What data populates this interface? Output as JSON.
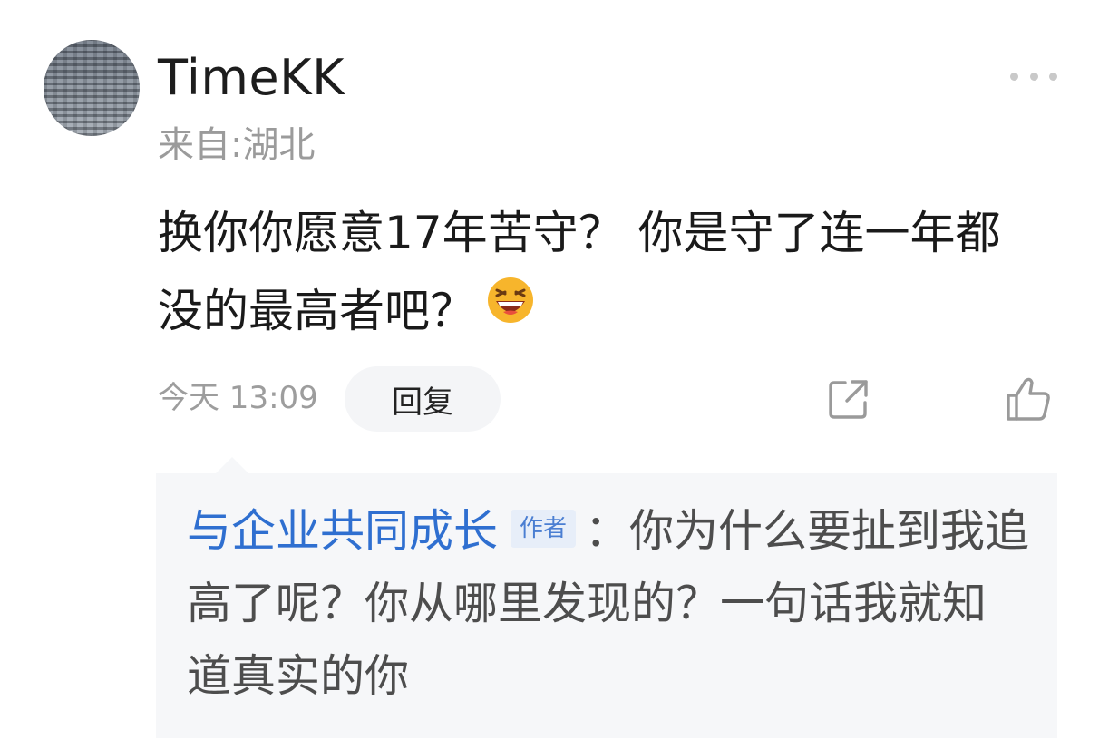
{
  "comment": {
    "username": "TimeKK",
    "location": "来自:湖北",
    "text": "换你你愿意17年苦守？ 你是守了连一年都没的最高者吧？",
    "emoji": "laughing-face",
    "time": "今天 13:09",
    "reply_label": "回复"
  },
  "reply": {
    "author": "与企业共同成长",
    "author_tag": "作者",
    "text": "：你为什么要扯到我追高了呢？你从哪里发现的？一句话我就知道真实的你"
  },
  "colors": {
    "author_blue": "#2f6fd0",
    "muted_gray": "#9b9b9b",
    "reply_bg": "#f6f7f9"
  }
}
